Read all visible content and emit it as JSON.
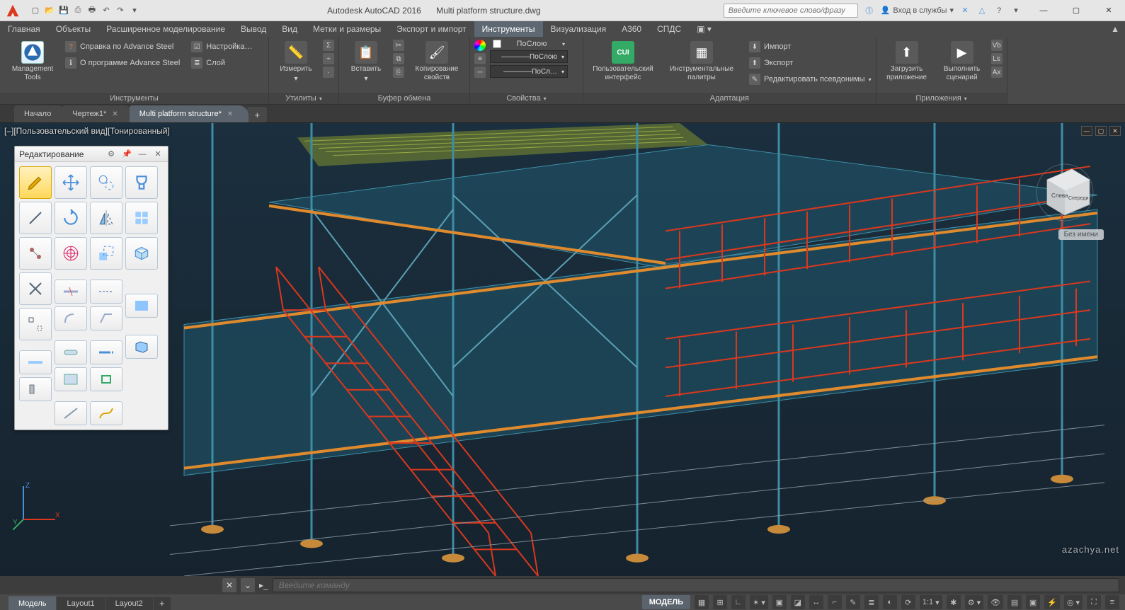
{
  "title": {
    "app": "Autodesk AutoCAD 2016",
    "doc": "Multi platform structure.dwg"
  },
  "search": {
    "placeholder": "Введите ключевое слово/фразу"
  },
  "login_label": "Вход в службы",
  "menu": {
    "items": [
      "Главная",
      "Объекты",
      "Расширенное моделирование",
      "Вывод",
      "Вид",
      "Метки и размеры",
      "Экспорт и импорт",
      "Инструменты",
      "Визуализация",
      "A360",
      "СПДС"
    ],
    "active": 7
  },
  "ribbon": {
    "panels": {
      "tools": {
        "label": "Инструменты",
        "mgmt": "Management Tools",
        "help": "Справка по Advance Steel",
        "about": "О программе Advance Steel",
        "settings": "Настройка…",
        "layer": "Слой"
      },
      "utils": {
        "label": "Утилиты",
        "measure": "Измерить"
      },
      "clip": {
        "label": "Буфер обмена",
        "paste": "Вставить",
        "copy": "Копирование свойств"
      },
      "props": {
        "label": "Свойства",
        "bylayer": "ПоСлою",
        "linewt": "ПоСлою",
        "linesty": "ПоСл…"
      },
      "adapt": {
        "label": "Адаптация",
        "cui": "Пользовательский интерфейс",
        "palettes": "Инструментальные палитры",
        "import": "Импорт",
        "export": "Экспорт",
        "alias": "Редактировать псевдонимы"
      },
      "apps": {
        "label": "Приложения",
        "load": "Загрузить приложение",
        "run": "Выполнить сценарий"
      }
    }
  },
  "file_tabs": {
    "items": [
      {
        "label": "Начало",
        "active": false,
        "closable": false
      },
      {
        "label": "Чертеж1*",
        "active": false,
        "closable": true
      },
      {
        "label": "Multi platform structure*",
        "active": true,
        "closable": true
      }
    ]
  },
  "viewport_label": "[–][Пользовательский вид][Тонированный]",
  "viewcube": {
    "left": "Слева",
    "front": "Спереди"
  },
  "unnamed_label": "Без имени",
  "palette": {
    "title": "Редактирование"
  },
  "cmdline": {
    "placeholder": "Введите команду"
  },
  "layout_tabs": {
    "items": [
      "Модель",
      "Layout1",
      "Layout2"
    ],
    "active": 0
  },
  "status": {
    "model": "МОДЕЛЬ",
    "scale": "1:1"
  },
  "watermark": "azachya.net"
}
